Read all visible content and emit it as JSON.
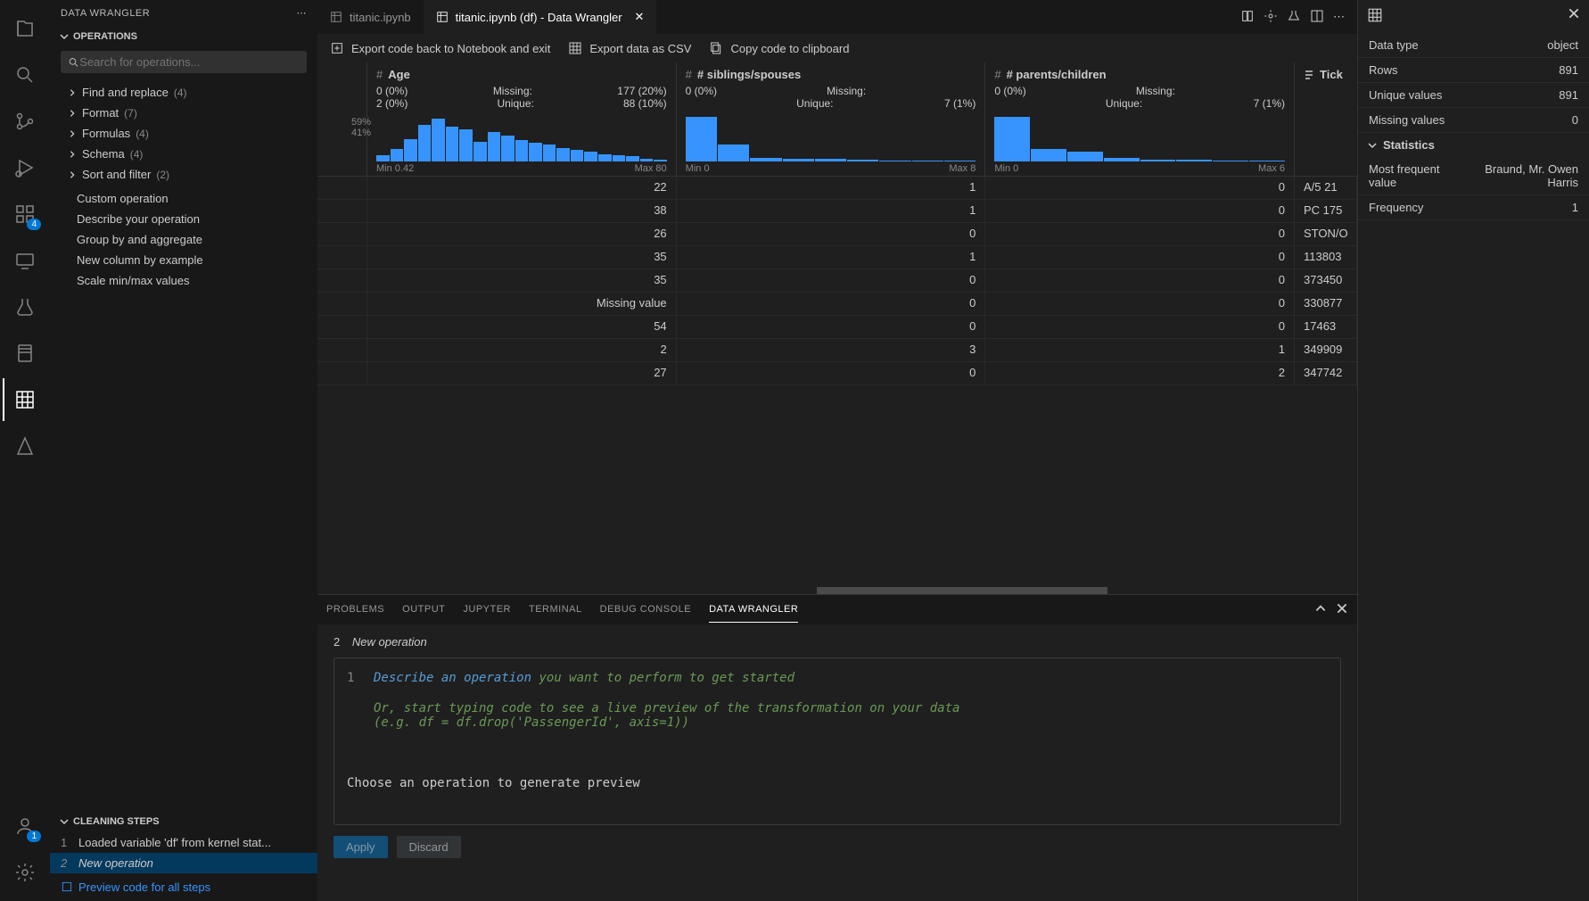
{
  "sidebar_title": "DATA WRANGLER",
  "operations": {
    "header": "OPERATIONS",
    "search_placeholder": "Search for operations...",
    "groups": [
      {
        "label": "Find and replace",
        "count": "(4)"
      },
      {
        "label": "Format",
        "count": "(7)"
      },
      {
        "label": "Formulas",
        "count": "(4)"
      },
      {
        "label": "Schema",
        "count": "(4)"
      },
      {
        "label": "Sort and filter",
        "count": "(2)"
      }
    ],
    "items": [
      {
        "label": "Custom operation"
      },
      {
        "label": "Describe your operation"
      },
      {
        "label": "Group by and aggregate"
      },
      {
        "label": "New column by example"
      },
      {
        "label": "Scale min/max values"
      }
    ]
  },
  "cleaning": {
    "header": "CLEANING STEPS",
    "steps": [
      {
        "n": "1",
        "label": "Loaded variable 'df' from kernel stat..."
      },
      {
        "n": "2",
        "label": "New operation"
      }
    ],
    "preview": "Preview code for all steps"
  },
  "tabs": [
    {
      "label": "titanic.ipynb",
      "active": false,
      "icon": "notebook-icon"
    },
    {
      "label": "titanic.ipynb (df) - Data Wrangler",
      "active": true,
      "icon": "wrangler-icon"
    }
  ],
  "toolbar": {
    "export_nb": "Export code back to Notebook and exit",
    "export_csv": "Export data as CSV",
    "copy": "Copy code to clipboard"
  },
  "columns": [
    {
      "name": "Age",
      "type": "#",
      "left1": "0 (0%)",
      "left2": "2 (0%)",
      "missing": "177 (20%)",
      "unique": "88 (10%)",
      "min": "Min 0.42",
      "max": "Max 80",
      "pct_top": "59%",
      "pct_bot": "41%",
      "bars": [
        14,
        28,
        50,
        82,
        96,
        78,
        72,
        44,
        66,
        58,
        48,
        42,
        38,
        30,
        26,
        22,
        16,
        14,
        12,
        6,
        4
      ]
    },
    {
      "name": "# siblings/spouses",
      "type": "#",
      "left1": "0 (0%)",
      "left2": "",
      "missing": "",
      "unique": "7 (1%)",
      "min": "Min 0",
      "max": "Max 8",
      "bars": [
        100,
        38,
        8,
        6,
        6,
        4,
        2,
        2,
        2
      ]
    },
    {
      "name": "# parents/children",
      "type": "#",
      "left1": "0 (0%)",
      "left2": "",
      "missing": "",
      "unique": "7 (1%)",
      "min": "Min 0",
      "max": "Max 6",
      "bars": [
        100,
        28,
        22,
        8,
        4,
        4,
        2,
        2
      ]
    }
  ],
  "last_col": "Tick",
  "rows": [
    {
      "age": "22",
      "sib": "1",
      "par": "0",
      "ticket": "A/5 21"
    },
    {
      "age": "38",
      "sib": "1",
      "par": "0",
      "ticket": "PC 175"
    },
    {
      "age": "26",
      "sib": "0",
      "par": "0",
      "ticket": "STON/O"
    },
    {
      "age": "35",
      "sib": "1",
      "par": "0",
      "ticket": "113803"
    },
    {
      "age": "35",
      "sib": "0",
      "par": "0",
      "ticket": "373450"
    },
    {
      "age": "Missing value",
      "sib": "0",
      "par": "0",
      "ticket": "330877"
    },
    {
      "age": "54",
      "sib": "0",
      "par": "0",
      "ticket": "17463"
    },
    {
      "age": "2",
      "sib": "3",
      "par": "1",
      "ticket": "349909"
    },
    {
      "age": "27",
      "sib": "0",
      "par": "2",
      "ticket": "347742"
    }
  ],
  "panel_tabs": [
    "PROBLEMS",
    "OUTPUT",
    "JUPYTER",
    "TERMINAL",
    "DEBUG CONSOLE",
    "DATA WRANGLER"
  ],
  "panel": {
    "step_n": "2",
    "step_title": "New operation",
    "code_ln": "1",
    "code_kw": "Describe an operation",
    "code_rest": " you want to perform to get started",
    "code_l2": "Or, start typing code to see a live preview of the transformation on your data",
    "code_l3": "(e.g. df = df.drop('PassengerId', axis=1))",
    "hint": "Choose an operation to generate preview",
    "apply": "Apply",
    "discard": "Discard"
  },
  "right": {
    "type_k": "Data type",
    "type_v": "object",
    "rows_k": "Rows",
    "rows_v": "891",
    "uniq_k": "Unique values",
    "uniq_v": "891",
    "miss_k": "Missing values",
    "miss_v": "0",
    "stats": "Statistics",
    "mfv_k": "Most frequent value",
    "mfv_v": "Braund, Mr. Owen Harris",
    "freq_k": "Frequency",
    "freq_v": "1"
  },
  "missing_label": "Missing:",
  "unique_label": "Unique:",
  "activity_badges": {
    "ext": "4",
    "acct": "1"
  }
}
